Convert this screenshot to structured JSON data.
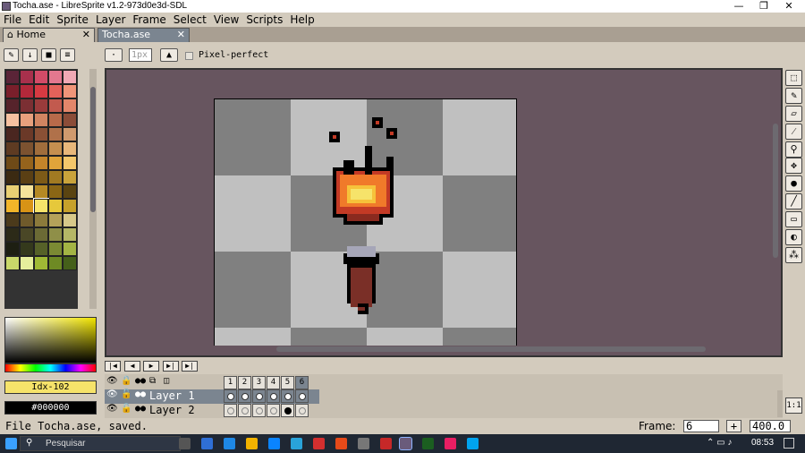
{
  "window": {
    "title": "Tocha.ase - LibreSprite v1.2-973d0e3d-SDL",
    "minimize": "—",
    "restore": "❐",
    "close": "✕"
  },
  "menu": [
    "File",
    "Edit",
    "Sprite",
    "Layer",
    "Frame",
    "Select",
    "View",
    "Scripts",
    "Help"
  ],
  "tabs": {
    "home": "Home",
    "file": "Tocha.ase",
    "close": "✕"
  },
  "toolbar": {
    "brush_size": "1px",
    "pixel_perfect": "Pixel-perfect"
  },
  "palette_colors": [
    "#5a2437",
    "#a8304c",
    "#d24b67",
    "#e3788f",
    "#f0a9b5",
    "#7a1f2b",
    "#b3283a",
    "#d63a42",
    "#e4625a",
    "#f19579",
    "#56232b",
    "#7b2f33",
    "#9a3b3b",
    "#c25a4e",
    "#e3866a",
    "#f6c1a1",
    "#e7a07d",
    "#d18461",
    "#b86a4a",
    "#8b4c38",
    "#4a2620",
    "#6b3928",
    "#8a5035",
    "#b0714a",
    "#d09a6e",
    "#5e3b22",
    "#7c5230",
    "#a06d3c",
    "#c58f4f",
    "#e8b77a",
    "#6e4a17",
    "#95631c",
    "#c3842a",
    "#e0a43a",
    "#f4c76b",
    "#3b2a12",
    "#5a3f14",
    "#7d5a17",
    "#a17a22",
    "#c9a33b",
    "#e8cf74",
    "#f5e39b",
    "#b58924",
    "#8a6615",
    "#5a4411",
    "#f2b529",
    "#d89316",
    "#f6e36a",
    "#e6c83b",
    "#c6a12b",
    "#4b3a1b",
    "#6f5a2b",
    "#8c7a3b",
    "#b5a25a",
    "#d7c98a",
    "#2c2a18",
    "#4a4726",
    "#6b6a35",
    "#8f8f48",
    "#b5b766",
    "#1d1f12",
    "#34391c",
    "#566128",
    "#7b8a33",
    "#a3b444",
    "#c9d86a",
    "#e6ef9c",
    "#a0b935",
    "#6e8a24",
    "#45601a"
  ],
  "color_bar": {
    "foreground": "Idx-102",
    "background": "#000000"
  },
  "timeline": {
    "frames": [
      "1",
      "2",
      "3",
      "4",
      "5",
      "6"
    ],
    "layers": [
      {
        "name": "Layer 1",
        "cels": [
          "filled",
          "filled",
          "filled",
          "filled",
          "filled",
          "filled"
        ]
      },
      {
        "name": "Layer 2",
        "cels": [
          "empty",
          "empty",
          "empty",
          "empty",
          "filled-black",
          "empty"
        ]
      }
    ]
  },
  "status": {
    "message": "File Tocha.ase, saved.",
    "frame_label": "Frame:",
    "frame_value": "6",
    "add_frame": "+",
    "zoom": "400.0",
    "zoom_reset": "1:1"
  },
  "taskbar": {
    "search_placeholder": "Pesquisar",
    "time": "08:53"
  },
  "colors": {
    "canvas_bg": "#67555f",
    "ui_bg": "#d3cbbd",
    "selected_row": "#7b8590",
    "fg_swatch": "#f6e36a"
  }
}
